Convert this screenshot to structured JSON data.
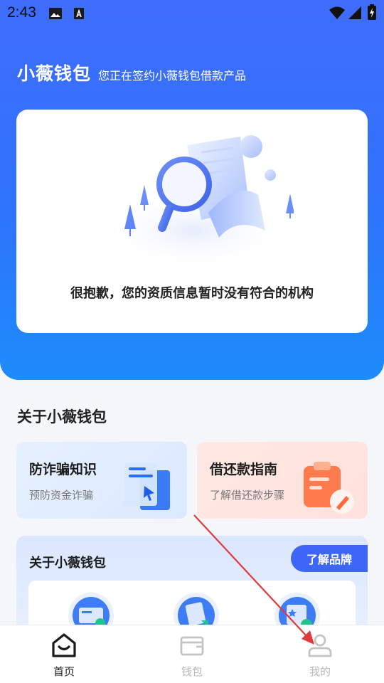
{
  "status_bar": {
    "time": "2:43"
  },
  "header": {
    "title": "小薇钱包",
    "subtitle": "您正在签约小薇钱包借款产品"
  },
  "result": {
    "message": "很抱歉，您的资质信息暂时没有符合的机构"
  },
  "about_section": {
    "title": "关于小薇钱包",
    "cards": [
      {
        "title": "防诈骗知识",
        "subtitle": "预防资金诈骗"
      },
      {
        "title": "借还款指南",
        "subtitle": "了解借还款步骤"
      }
    ],
    "panel_title": "关于小薇钱包",
    "brand_button": "了解品牌"
  },
  "bottom_nav": {
    "items": [
      {
        "label": "首页",
        "icon": "home-icon",
        "active": true
      },
      {
        "label": "钱包",
        "icon": "wallet-icon",
        "active": false
      },
      {
        "label": "我的",
        "icon": "user-icon",
        "active": false
      }
    ]
  },
  "colors": {
    "primary": "#3d66f6",
    "header_gradient_top": "#3f6cfb",
    "header_gradient_bottom": "#1e8cfb",
    "annotation_arrow": "#e03a3a"
  }
}
